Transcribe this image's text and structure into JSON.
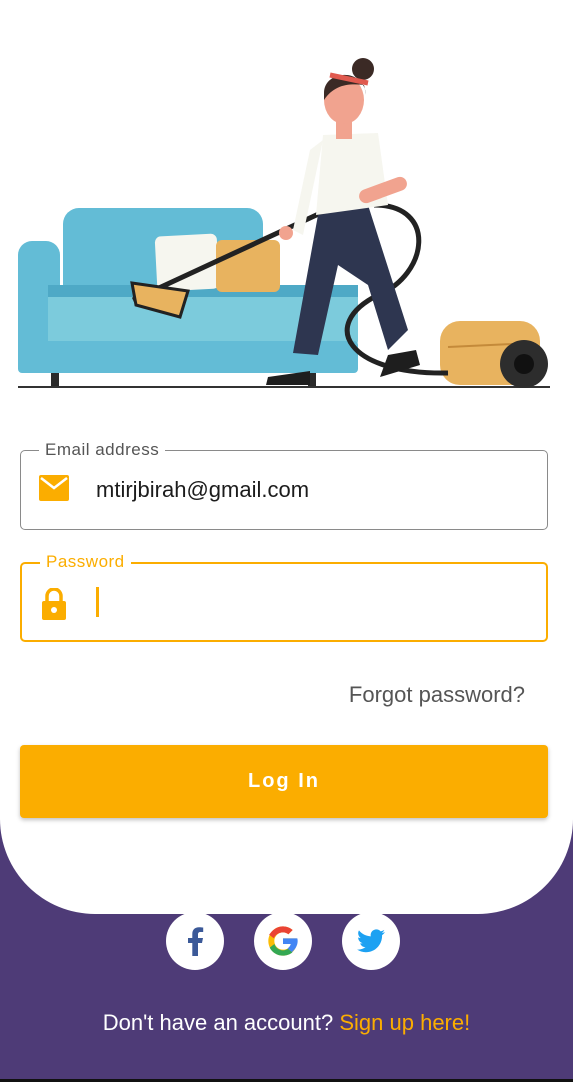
{
  "login_form": {
    "email": {
      "label": "Email address",
      "value": "mtirjbirah@gmail.com"
    },
    "password": {
      "label": "Password",
      "value": ""
    },
    "forgot_password": "Forgot password?",
    "login_button": "Log In"
  },
  "social_login": {
    "icons": [
      "facebook-icon",
      "google-icon",
      "twitter-icon"
    ]
  },
  "footer": {
    "prompt": "Don't have an account?",
    "signup_link": "Sign up here!"
  },
  "colors": {
    "accent": "#fbad00",
    "background_purple": "#4e3b77",
    "card": "#ffffff",
    "facebook": "#3b5998",
    "twitter": "#1da1f2"
  }
}
